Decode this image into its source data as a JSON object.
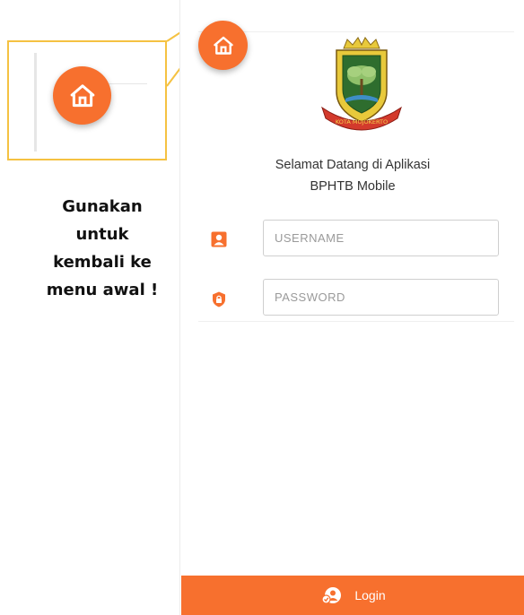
{
  "annotation": {
    "instruction_lines": [
      "Gunakan",
      "untuk",
      "kembali ke",
      "menu awal !"
    ]
  },
  "app": {
    "logo_text": "KOTA MOJOKERTO",
    "welcome_line1": "Selamat Datang di Aplikasi",
    "welcome_line2": "BPHTB Mobile",
    "username_placeholder": "USERNAME",
    "password_placeholder": "PASSWORD",
    "login_label": "Login"
  },
  "colors": {
    "accent": "#f7702e",
    "callout_border": "#f5c242",
    "shield_yellow": "#e8c93b",
    "shield_green": "#2e6d2e"
  },
  "icons": {
    "home": "home-icon",
    "user": "user-icon",
    "lock": "lock-icon",
    "login": "login-icon"
  }
}
